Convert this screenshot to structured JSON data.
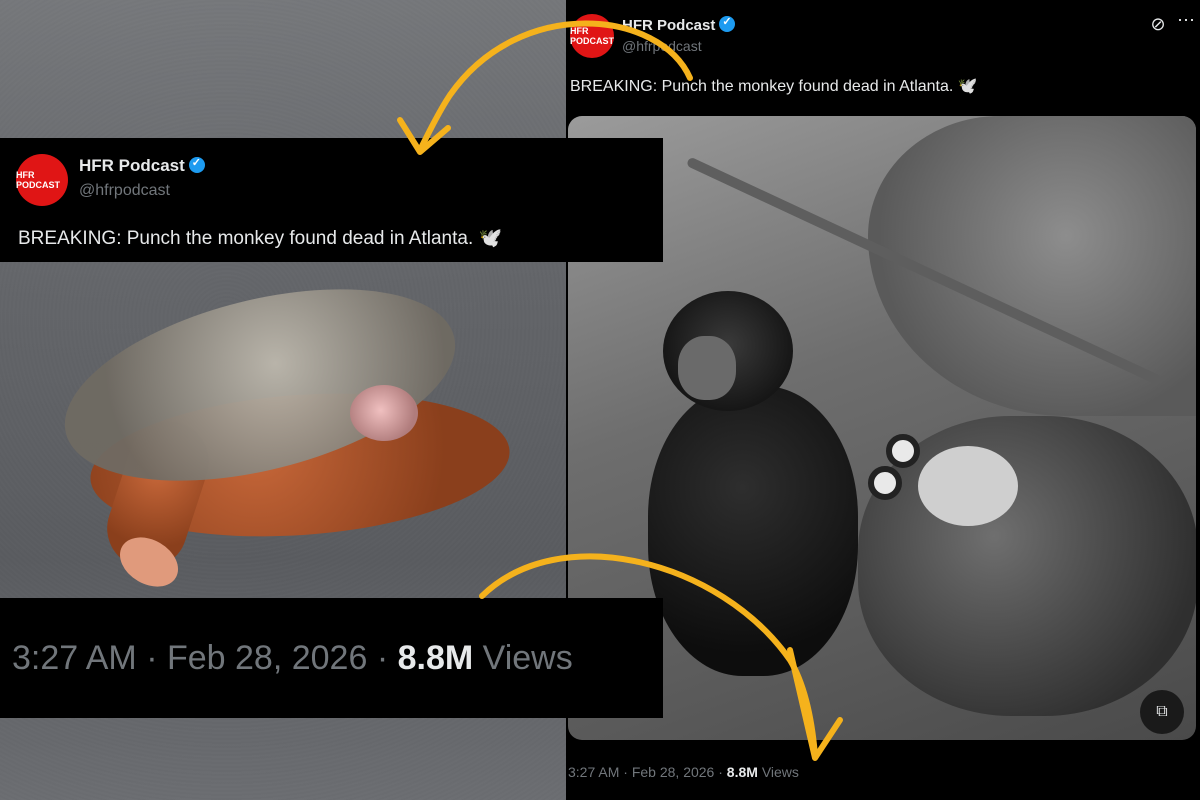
{
  "tweet": {
    "display_name": "HFR Podcast",
    "handle": "@hfrpodcast",
    "avatar_text": "HFR PODCAST",
    "text": "BREAKING: Punch the monkey found dead in Atlanta. 🕊️",
    "time": "3:27 AM",
    "date": "Feb 28, 2026",
    "views_count": "8.8M",
    "views_label": "Views",
    "separator": "·"
  },
  "icons": {
    "verified": "verified-badge-icon",
    "grok": "grok-icon",
    "more": "more-icon",
    "media_action": "media-edit-icon"
  },
  "colors": {
    "background": "#000000",
    "text_primary": "#e7e9ea",
    "text_secondary": "#71767b",
    "verified": "#1d9bf0",
    "avatar": "#e01515",
    "arrow": "#f5b21c"
  }
}
